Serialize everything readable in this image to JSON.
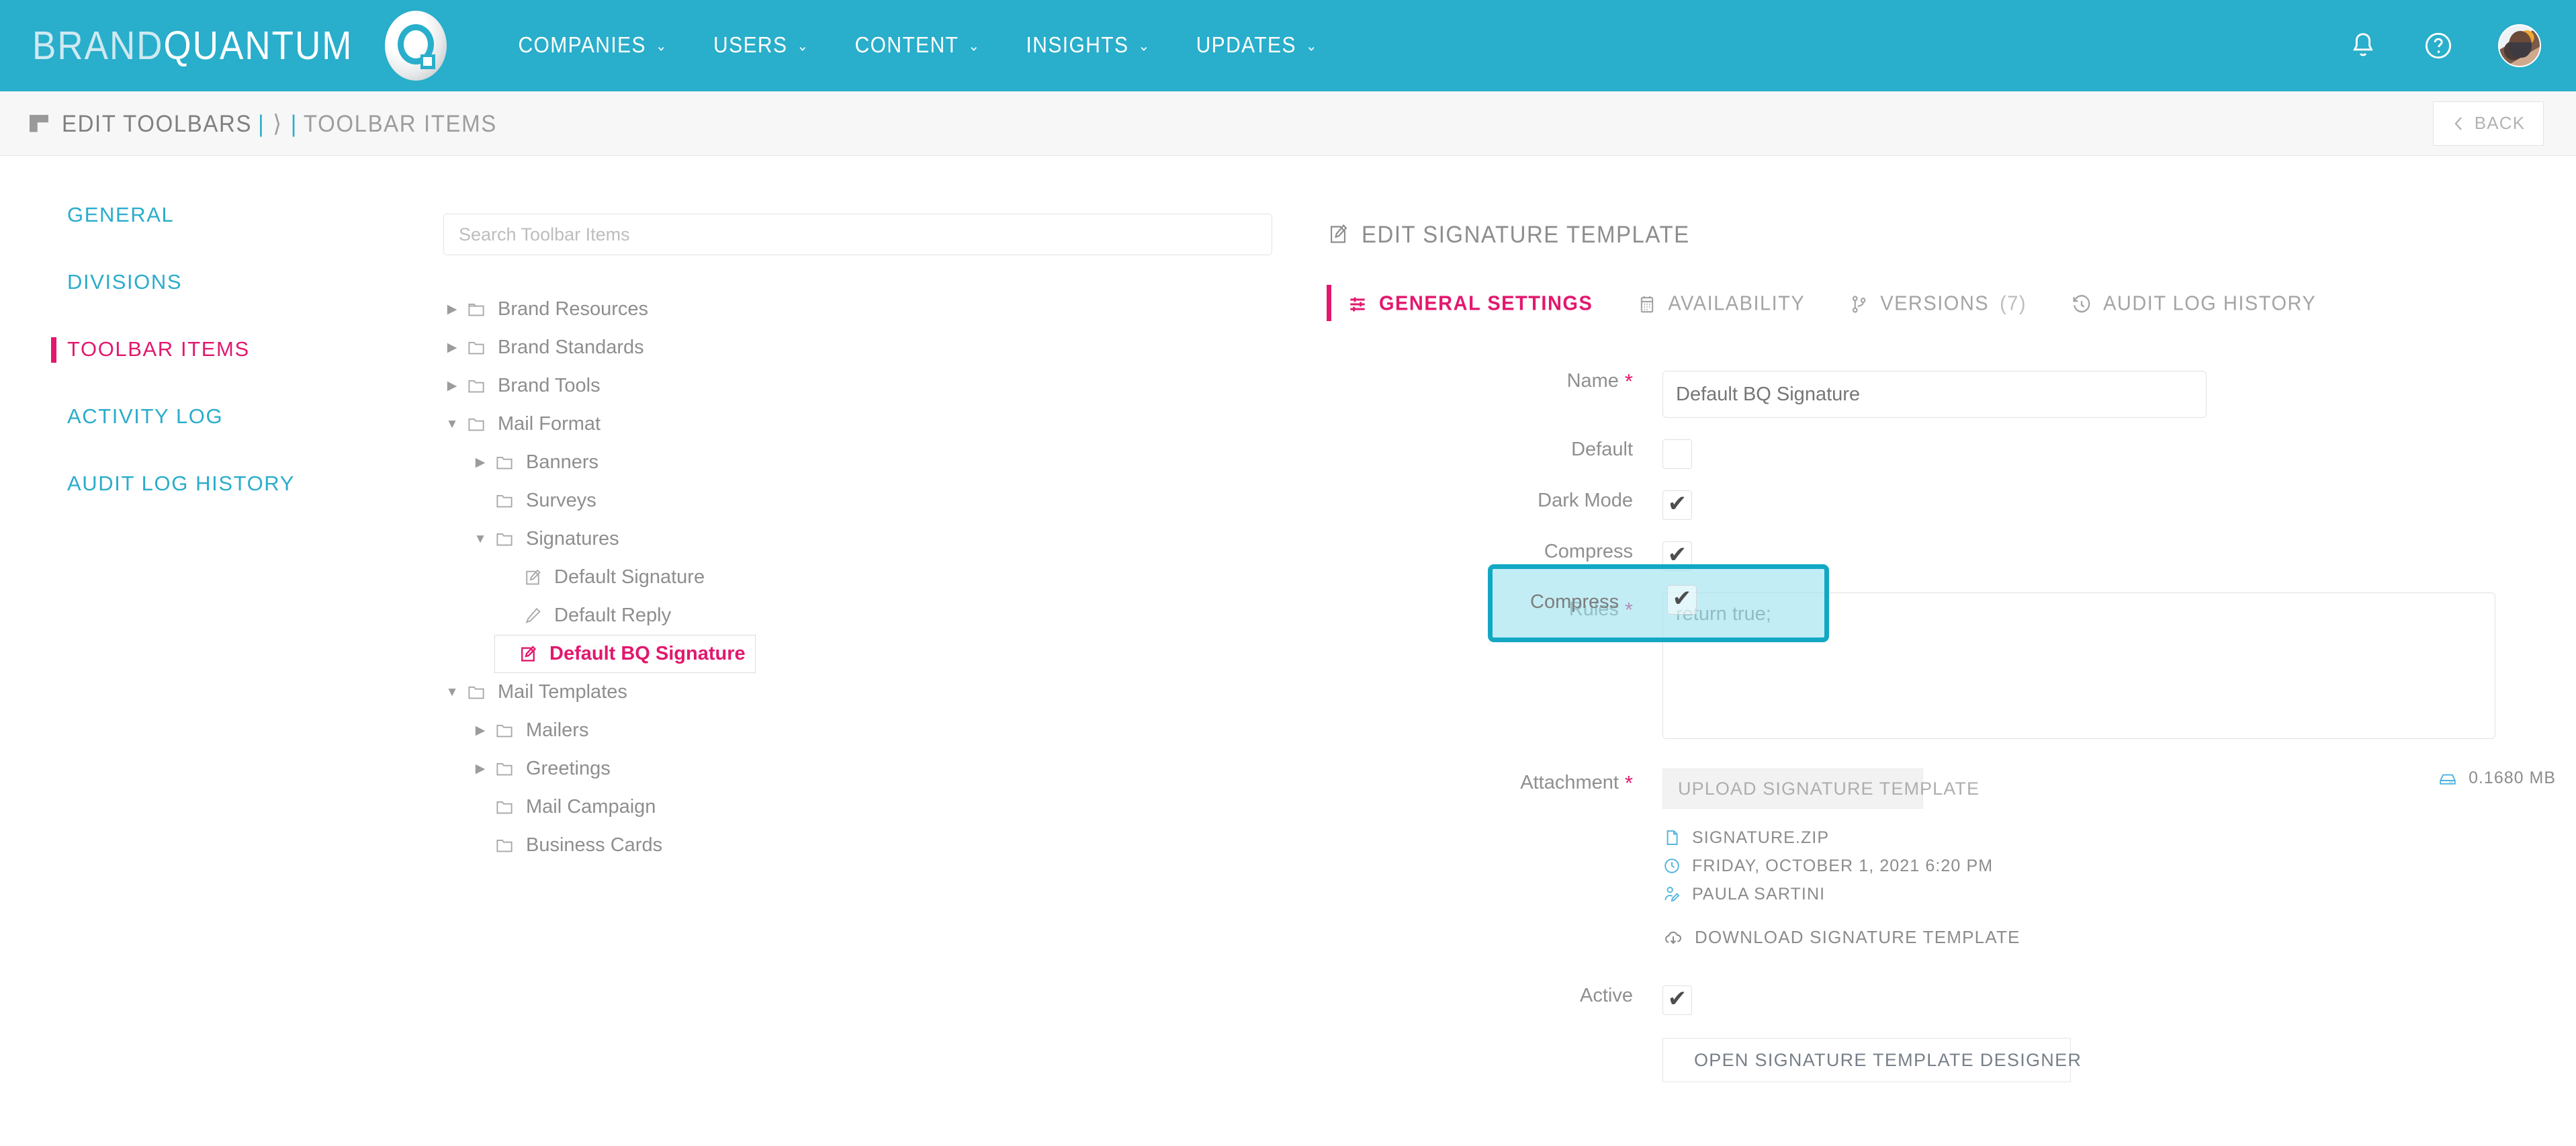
{
  "colors": {
    "brand_cyan": "#29aecb",
    "accent_pink": "#e2186e",
    "highlight_border": "#12a8c4",
    "muted_text": "#8c8c8c"
  },
  "topnav": {
    "logotype_prefix": "BRAND",
    "logotype_suffix": "QUANTUM",
    "logo_icon": "brandquantum-q-logo",
    "items": [
      {
        "label": "COMPANIES",
        "caret": "⌄"
      },
      {
        "label": "USERS",
        "caret": "⌄"
      },
      {
        "label": "CONTENT",
        "caret": "⌄"
      },
      {
        "label": "INSIGHTS",
        "caret": "⌄"
      },
      {
        "label": "UPDATES",
        "caret": "⌄"
      }
    ],
    "notifications_icon": "bell-icon",
    "help_icon": "question-circle-icon",
    "avatar_icon": "user-avatar"
  },
  "subheader": {
    "crumb_icon": "corner-flag-icon",
    "crumb_primary": "EDIT TOOLBARS",
    "crumb_sep1": "|",
    "crumb_arrow": "⟩",
    "crumb_sep2": "|",
    "crumb_last": "TOOLBAR ITEMS",
    "back_label": "BACK",
    "back_icon": "chevron-left-icon"
  },
  "sidebar": {
    "items": [
      {
        "label": "GENERAL",
        "active": false
      },
      {
        "label": "DIVISIONS",
        "active": false
      },
      {
        "label": "TOOLBAR ITEMS",
        "active": true
      },
      {
        "label": "ACTIVITY LOG",
        "active": false
      },
      {
        "label": "AUDIT LOG HISTORY",
        "active": false
      }
    ]
  },
  "tree_panel": {
    "search_placeholder": "Search Toolbar Items",
    "search_value": "",
    "nodes": [
      {
        "label": "Brand Resources",
        "depth": 0,
        "icon": "folder-icon",
        "twisty": "collapsed",
        "selected": false
      },
      {
        "label": "Brand Standards",
        "depth": 0,
        "icon": "folder-icon",
        "twisty": "collapsed",
        "selected": false
      },
      {
        "label": "Brand Tools",
        "depth": 0,
        "icon": "folder-icon",
        "twisty": "collapsed",
        "selected": false
      },
      {
        "label": "Mail Format",
        "depth": 0,
        "icon": "folder-icon",
        "twisty": "expanded",
        "selected": false
      },
      {
        "label": "Banners",
        "depth": 1,
        "icon": "folder-icon",
        "twisty": "collapsed",
        "selected": false
      },
      {
        "label": "Surveys",
        "depth": 1,
        "icon": "folder-icon",
        "twisty": "none",
        "selected": false
      },
      {
        "label": "Signatures",
        "depth": 1,
        "icon": "folder-icon",
        "twisty": "expanded",
        "selected": false
      },
      {
        "label": "Default Signature",
        "depth": 2,
        "icon": "signature-edit-icon",
        "twisty": "none",
        "selected": false
      },
      {
        "label": "Default Reply",
        "depth": 2,
        "icon": "pen-icon",
        "twisty": "none",
        "selected": false
      },
      {
        "label": "Default BQ Signature",
        "depth": 2,
        "icon": "signature-edit-icon",
        "twisty": "none",
        "selected": true
      },
      {
        "label": "Mail Templates",
        "depth": 0,
        "icon": "folder-icon",
        "twisty": "expanded",
        "selected": false
      },
      {
        "label": "Mailers",
        "depth": 1,
        "icon": "folder-icon",
        "twisty": "collapsed",
        "selected": false
      },
      {
        "label": "Greetings",
        "depth": 1,
        "icon": "folder-icon",
        "twisty": "collapsed",
        "selected": false
      },
      {
        "label": "Mail Campaign",
        "depth": 1,
        "icon": "folder-icon",
        "twisty": "none",
        "selected": false
      },
      {
        "label": "Business Cards",
        "depth": 1,
        "icon": "folder-icon",
        "twisty": "none",
        "selected": false
      }
    ]
  },
  "panel": {
    "title": "EDIT SIGNATURE TEMPLATE",
    "title_icon": "signature-edit-icon",
    "tabs": [
      {
        "label": "GENERAL SETTINGS",
        "icon": "sliders-icon",
        "count": "",
        "active": true
      },
      {
        "label": "AVAILABILITY",
        "icon": "calendar-icon",
        "count": "",
        "active": false
      },
      {
        "label": "VERSIONS",
        "icon": "branch-icon",
        "count": "(7)",
        "active": false
      },
      {
        "label": "AUDIT LOG HISTORY",
        "icon": "history-clock-icon",
        "count": "",
        "active": false
      }
    ],
    "form": {
      "name_label": "Name",
      "name_required": "*",
      "name_value": "Default BQ Signature",
      "name_placeholder": "",
      "default_label": "Default",
      "default_checked": false,
      "dark_mode_label": "Dark Mode",
      "dark_mode_checked": true,
      "compress_label": "Compress",
      "compress_checked": true,
      "check_mark": "✔",
      "rules_label": "Rules",
      "rules_required": "*",
      "rules_value": "return true;",
      "attachment_label": "Attachment",
      "attachment_required": "*",
      "upload_button": "UPLOAD SIGNATURE TEMPLATE",
      "file_name": "SIGNATURE.ZIP",
      "file_name_icon": "file-icon",
      "file_date": "FRIDAY, OCTOBER 1, 2021 6:20 PM",
      "file_date_icon": "clock-icon",
      "file_author": "PAULA SARTINI",
      "file_author_icon": "user-edit-icon",
      "file_size": "0.1680 MB",
      "file_size_icon": "hard-drive-icon",
      "download_label": "DOWNLOAD SIGNATURE TEMPLATE",
      "download_icon": "cloud-download-icon",
      "active_label": "Active",
      "active_checked": true,
      "designer_button": "OPEN SIGNATURE TEMPLATE DESIGNER",
      "designer_icon": "ribbon-icon"
    }
  }
}
